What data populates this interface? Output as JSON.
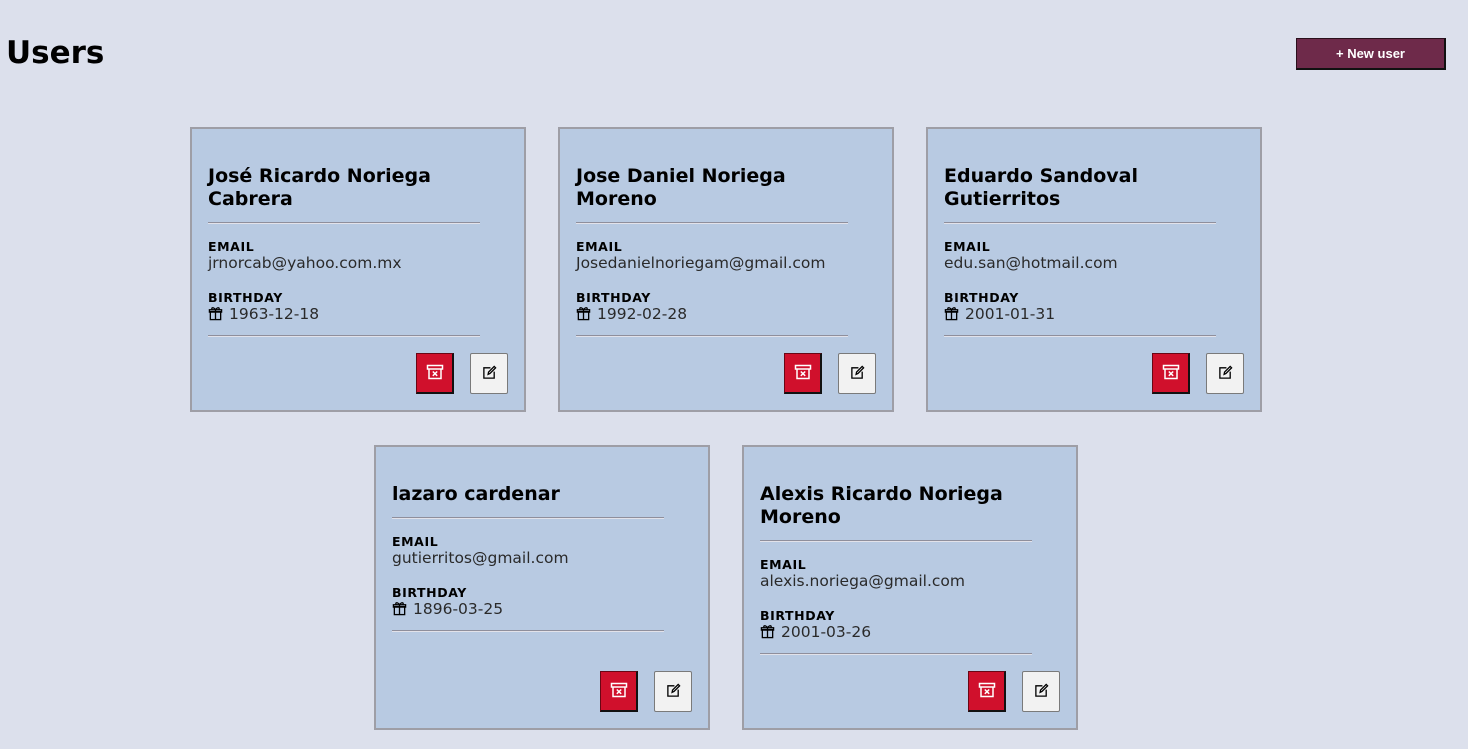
{
  "page": {
    "title": "Users",
    "new_user_label": "+ New user"
  },
  "users": [
    {
      "name": "José Ricardo Noriega Cabrera",
      "email_label": "EMAIL",
      "email": "jrnorcab@yahoo.com.mx",
      "birthday_label": "BIRTHDAY",
      "birthday": "1963-12-18"
    },
    {
      "name": "Jose Daniel Noriega Moreno",
      "email_label": "EMAIL",
      "email": "Josedanielnoriegam@gmail.com",
      "birthday_label": "BIRTHDAY",
      "birthday": "1992-02-28"
    },
    {
      "name": "Eduardo Sandoval Gutierritos",
      "email_label": "EMAIL",
      "email": "edu.san@hotmail.com",
      "birthday_label": "BIRTHDAY",
      "birthday": "2001-01-31"
    },
    {
      "name": "lazaro cardenar",
      "email_label": "EMAIL",
      "email": "gutierritos@gmail.com",
      "birthday_label": "BIRTHDAY",
      "birthday": "1896-03-25"
    },
    {
      "name": "Alexis Ricardo Noriega Moreno",
      "email_label": "EMAIL",
      "email": "alexis.noriega@gmail.com",
      "birthday_label": "BIRTHDAY",
      "birthday": "2001-03-26"
    }
  ],
  "icons": {
    "birthday": "gift-icon",
    "delete": "trash-icon",
    "edit": "edit-icon"
  },
  "colors": {
    "background": "#dce0ec",
    "card": "#b8cae2",
    "primary_button": "#6e2a4a",
    "delete_button": "#d0102c",
    "edit_button": "#f2f2f2"
  }
}
